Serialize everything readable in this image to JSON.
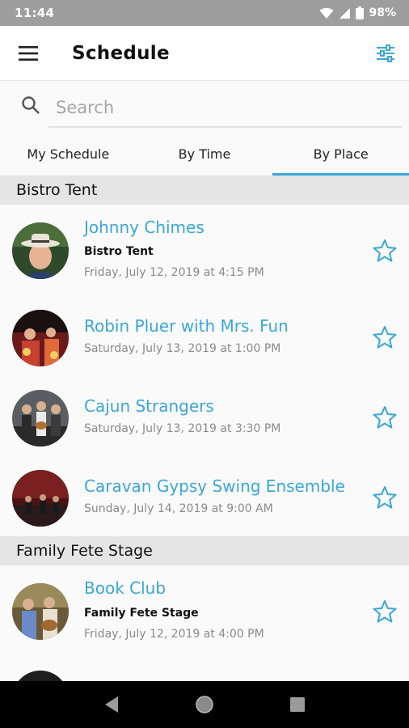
{
  "status_bar": {
    "time": "11:44",
    "battery": "98%"
  },
  "app_bar": {
    "title": "Schedule"
  },
  "search": {
    "placeholder": "Search"
  },
  "tabs": [
    {
      "label": "My Schedule",
      "active": false
    },
    {
      "label": "By Time",
      "active": false
    },
    {
      "label": "By Place",
      "active": true
    }
  ],
  "sections": [
    {
      "title": "Bistro Tent",
      "items": [
        {
          "name": "Johnny Chimes",
          "venue": "Bistro Tent",
          "date": "Friday, July 12, 2019 at 4:15 PM"
        },
        {
          "name": "Robin Pluer with Mrs. Fun",
          "venue": "",
          "date": "Saturday, July 13, 2019 at 1:00 PM"
        },
        {
          "name": "Cajun Strangers",
          "venue": "",
          "date": "Saturday, July 13, 2019 at 3:30 PM"
        },
        {
          "name": "Caravan Gypsy Swing Ensemble",
          "venue": "",
          "date": "Sunday, July 14, 2019 at 9:00 AM"
        }
      ]
    },
    {
      "title": "Family Fete Stage",
      "items": [
        {
          "name": "Book Club",
          "venue": "Family Fete Stage",
          "date": "Friday, July 12, 2019 at 4:00 PM"
        }
      ]
    }
  ],
  "colors": {
    "accent": "#3aa6d8",
    "status_bar": "#9e9e9e",
    "section_bg": "#e5e5e5"
  },
  "icons": [
    "menu-icon",
    "filter-icon",
    "search-icon",
    "star-outline-icon",
    "back-icon",
    "home-icon",
    "recents-icon",
    "wifi-icon",
    "signal-icon",
    "battery-icon"
  ]
}
